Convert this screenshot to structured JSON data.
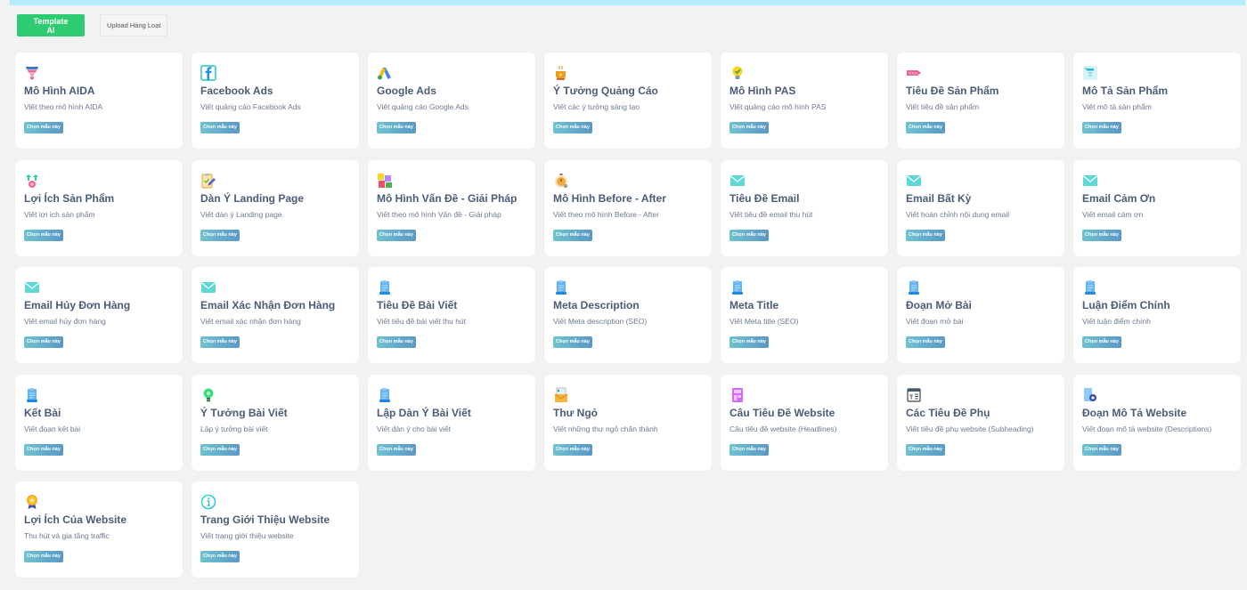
{
  "toolbar": {
    "template_ai_label": "Template AI",
    "upload_label": "Upload Hàng Loạt"
  },
  "badge_label": "Chọn mẫu này",
  "colors": {
    "primary_green": "#2ecc71",
    "banner": "#b3ecfc",
    "title": "#4a5b78",
    "badge_from": "#6ec3d0",
    "badge_to": "#5a97c6"
  },
  "templates": [
    {
      "icon": "funnel-icon",
      "title": "Mô Hình AIDA",
      "desc": "Viết theo mô hình AIDA"
    },
    {
      "icon": "facebook-icon",
      "title": "Facebook Ads",
      "desc": "Viết quảng cáo Facebook Ads"
    },
    {
      "icon": "google-ads-icon",
      "title": "Google Ads",
      "desc": "Viết quảng cáo Google Ads"
    },
    {
      "icon": "coffee-cup-icon",
      "title": "Ý Tưởng Quảng Cáo",
      "desc": "Viết các ý tưởng sáng tạo"
    },
    {
      "icon": "lightbulb-check-icon",
      "title": "Mô Hình PAS",
      "desc": "Viết quảng cáo mô hình PAS"
    },
    {
      "icon": "title-tag-icon",
      "title": "Tiêu Đề Sản Phẩm",
      "desc": "Viết tiêu đề sản phẩm"
    },
    {
      "icon": "text-description-icon",
      "title": "Mô Tả Sản Phẩm",
      "desc": "Viết mô tả sản phẩm"
    },
    {
      "icon": "benefit-arrows-icon",
      "title": "Lợi Ích Sản Phẩm",
      "desc": "Viết lợi ích sản phẩm"
    },
    {
      "icon": "clipboard-pen-icon",
      "title": "Dàn Ý Landing Page",
      "desc": "Viết dàn ý Landing page"
    },
    {
      "icon": "puzzle-icon",
      "title": "Mô Hình Vấn Đề - Giải Pháp",
      "desc": "Viết theo mô hình Vấn đề - Giải pháp"
    },
    {
      "icon": "stopwatch-icon",
      "title": "Mô Hình Before - After",
      "desc": "Viết theo mô hình Before - After"
    },
    {
      "icon": "envelope-icon",
      "title": "Tiêu Đề Email",
      "desc": "Viết tiêu đề email thu hút"
    },
    {
      "icon": "envelope-icon",
      "title": "Email Bất Kỳ",
      "desc": "Viết hoàn chỉnh nội dung email"
    },
    {
      "icon": "envelope-icon",
      "title": "Email Cảm Ơn",
      "desc": "Viết email cảm ơn"
    },
    {
      "icon": "envelope-icon",
      "title": "Email Hủy Đơn Hàng",
      "desc": "Viết email hủy đơn hàng"
    },
    {
      "icon": "envelope-icon",
      "title": "Email Xác Nhận Đơn Hàng",
      "desc": "Viết email xác nhận đơn hàng"
    },
    {
      "icon": "document-icon",
      "title": "Tiêu Đề Bài Viết",
      "desc": "Viết tiêu đề bài viết thu hút"
    },
    {
      "icon": "document-icon",
      "title": "Meta Description",
      "desc": "Viết Meta description (SEO)"
    },
    {
      "icon": "document-icon",
      "title": "Meta Title",
      "desc": "Viết Meta title (SEO)"
    },
    {
      "icon": "document-icon",
      "title": "Đoạn Mở Bài",
      "desc": "Viết đoạn mở bài"
    },
    {
      "icon": "document-icon",
      "title": "Luận Điểm Chính",
      "desc": "Viết luận điểm chính"
    },
    {
      "icon": "document-icon",
      "title": "Kết Bài",
      "desc": "Viết đoạn kết bài"
    },
    {
      "icon": "lightbulb-icon",
      "title": "Ý Tưởng Bài Viết",
      "desc": "Lập ý tưởng bài viết"
    },
    {
      "icon": "document-icon",
      "title": "Lập Dàn Ý Bài Viết",
      "desc": "Viết dàn ý cho bài viết"
    },
    {
      "icon": "letter-icon",
      "title": "Thư Ngỏ",
      "desc": "Viết những thư ngỏ chân thành"
    },
    {
      "icon": "website-headline-icon",
      "title": "Câu Tiêu Đề Website",
      "desc": "Câu tiêu đề website (Headlines)"
    },
    {
      "icon": "subheading-icon",
      "title": "Các Tiêu Đề Phụ",
      "desc": "Viết tiêu đề phụ website (Subheading)"
    },
    {
      "icon": "doc-gear-icon",
      "title": "Đoạn Mô Tả Website",
      "desc": "Viết đoạn mô tả website (Descriptions)"
    },
    {
      "icon": "award-medal-icon",
      "title": "Lợi Ích Của Website",
      "desc": "Thu hút và gia tăng traffic"
    },
    {
      "icon": "info-circle-icon",
      "title": "Trang Giới Thiệu Website",
      "desc": "Viết trang giới thiệu website"
    }
  ]
}
